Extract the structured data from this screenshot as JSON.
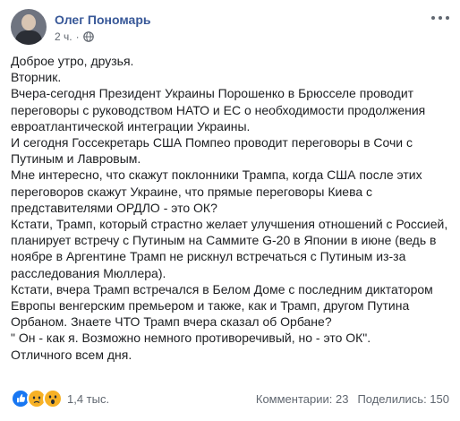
{
  "post": {
    "author": "Олег Пономарь",
    "time": "2 ч.",
    "separator": "·",
    "privacy_icon": "globe-icon",
    "more_icon": "more-options-icon",
    "lines": [
      "Доброе утро, друзья.",
      "Вторник.",
      "Вчера-сегодня Президент Украины Порошенко в Брюсселе проводит",
      "переговоры с руководством НАТО и ЕС о необходимости продолжения",
      "евроатлантической интеграции Украины.",
      "И сегодня Госсекретарь США Помпео проводит переговоры в Сочи с",
      "Путиным и Лавровым.",
      "Мне интересно, что скажут поклонники Трампа, когда США после этих",
      "переговоров скажут Украине, что прямые переговоры Киева с",
      "представителями ОРДЛО - это ОК?",
      "Кстати, Трамп, который страстно желает улучшения отношений с Россией,",
      "планирует встречу с Путиным на Саммите G-20 в Японии в июне (ведь в",
      "ноябре в Аргентине Трамп не рискнул встречаться с Путиным из-за",
      "расследования Мюллера).",
      "Кстати, вчера Трамп встречался в Белом Доме с последним диктатором",
      "Европы венгерским премьером и также, как и Трамп, другом Путина",
      "Орбаном. Знаете ЧТО Трамп вчера сказал об Орбане?",
      "\" Он - как я. Возможно немного противоречивый, но - это ОК\".",
      " Отличного всем дня."
    ]
  },
  "footer": {
    "reactions": [
      "like-icon",
      "sad-icon",
      "wow-icon"
    ],
    "reaction_count": "1,4 тыс.",
    "comments": "Комментарии: 23",
    "shares": "Поделились: 150"
  },
  "colors": {
    "author": "#385898",
    "meta": "#616770",
    "text": "#1c1e21",
    "like": "#1877f2",
    "emoji": "#f7b125"
  }
}
